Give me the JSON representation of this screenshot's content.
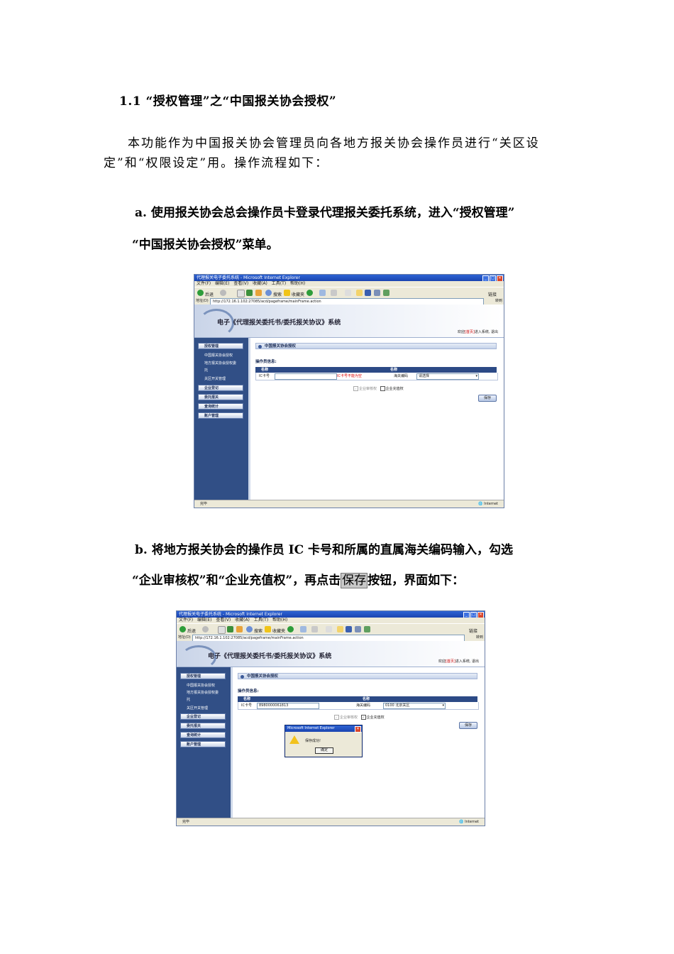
{
  "heading": "1.1 “授权管理”之“中国报关协会授权”",
  "intro": "本功能作为中国报关协会管理员向各地方报关协会操作员进行“关区设定”和“权限设定”用。操作流程如下：",
  "step_a": {
    "line1": "a. 使用报关协会总会操作员卡登录代理报关委托系统，进入“授权管理”",
    "line2": "“中国报关协会授权”菜单。"
  },
  "step_b": {
    "line1": "b. 将地方报关协会的操作员 IC 卡号和所属的直属海关编码输入，勾选",
    "line2_pre": "“企业审核权”和“企业充值权”，再点击",
    "line2_hl": "保存",
    "line2_post": "按钮，界面如下："
  },
  "screenshot": {
    "window_title": "代理报关电子委托系统 - Microsoft Internet Explorer",
    "menu": "文件(F) 编辑(E) 查看(V) 收藏(A) 工具(T) 帮助(H)",
    "toolbar_back": "后退",
    "toolbar_search": "搜索",
    "toolbar_favorites": "收藏夹",
    "toolbar_links": "链接",
    "address_label": "地址(D)",
    "address": "http://172.16.1.102:27085/acd/pageframe/mainFrame.action",
    "go": "转到",
    "system_title": "电子《代理报关委托书/委托报关协议》系统",
    "welcome_pre": "欢迎",
    "welcome_link": "[首页]",
    "welcome_post": "进入系统, 退出",
    "sidebar": {
      "auth_mgmt": "授权管理",
      "sub1": "中国报关协会授权",
      "sub2": "地方报关协会授权委",
      "sub2b": "托",
      "sub3": "关区开关管理",
      "enterprise": "企业登记",
      "entrust": "委托报关",
      "query": "查询统计",
      "account": "账户管理"
    },
    "section_title": "中国报关协会授权",
    "operator_info": "操作员信息:",
    "col_name": "名称",
    "row_ic": "IC卡号",
    "row_customs": "海关编码",
    "ic_error": "IC卡号不能为空",
    "ic_value": "8980000061813",
    "select_placeholder": "请选择",
    "select_value": "0100 北京关区",
    "chk_audit": "企业审核权",
    "chk_recharge": "企业充值权",
    "save": "保存",
    "status_done": "完毕",
    "status_zone": "Internet",
    "dialog_title": "Microsoft Internet Explorer",
    "dialog_msg": "保存成功!",
    "dialog_ok": "确定"
  }
}
